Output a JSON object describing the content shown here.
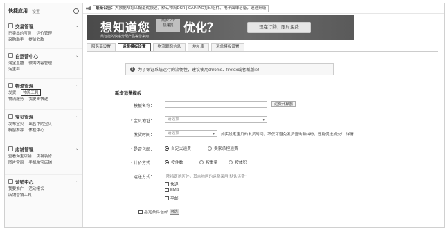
{
  "sidebar": {
    "title": "快捷应用",
    "settings": "设置",
    "sections": [
      {
        "title": "交易管理",
        "rows": [
          [
            "已卖出的宝贝",
            "评价管理"
          ],
          [
            "采购助手",
            "提前收款"
          ]
        ]
      },
      {
        "title": "自运营中心",
        "rows": [
          [
            "淘宝直播",
            "微淘内容管理"
          ],
          [
            "淘宝群"
          ]
        ]
      },
      {
        "title": "物流管理",
        "rows": [
          [
            "发货",
            "物流工具"
          ],
          [
            "物流服务",
            "我要寄快递"
          ]
        ]
      },
      {
        "title": "宝贝管理",
        "rows": [
          [
            "发布宝贝",
            "出售中的宝贝"
          ],
          [
            "橱窗推荐",
            "体检中心"
          ]
        ]
      },
      {
        "title": "店铺管理",
        "rows": [
          [
            "查看淘宝店铺",
            "店铺装修"
          ],
          [
            "图片空间",
            "手机淘宝店铺"
          ]
        ]
      },
      {
        "title": "营销中心",
        "rows": [
          [
            "我要推广",
            "活动报名"
          ],
          [
            "店铺营销工具"
          ]
        ]
      }
    ]
  },
  "notice": {
    "label": "最新公告：",
    "text": "大数据帮您匹配最优快递，默认物流DSR | CAINIAO打印组件、电子面单必备，速速升级"
  },
  "banner": {
    "headline_a": "想知道您",
    "box_line1": "最多少个",
    "box_line2": "快递员",
    "headline_b": "优化？",
    "subtitle": "最智能的快递分配产品等您来用！",
    "cta": "现在订购，限时免费"
  },
  "tabs": [
    "服务商设置",
    "运费模板设置",
    "物流跟踪信息",
    "地址库",
    "运单模板设置"
  ],
  "active_tab": "运费模板设置",
  "tip": "为了保证系统运行的流畅性，建议使用chrome、firefox或者新版ie！",
  "form": {
    "title": "新增运费模板",
    "template_name_label": "模板名称：",
    "template_name_value": "",
    "calc_button": "运费计算器",
    "location_label": "宝贝地址：",
    "location_placeholder": "请选择",
    "ship_time_label": "发货时间：",
    "ship_time_placeholder": "请选择",
    "ship_time_note": "如实设定宝贝的发货时间，不仅可避免发货咨询和纠纷，还能促进成交！",
    "ship_time_link": "详情",
    "free_ship_label": "是否包邮：",
    "free_ship_options": [
      "自定义运费",
      "卖家承担运费"
    ],
    "free_ship_selected": "自定义运费",
    "pricing_label": "计价方式：",
    "pricing_options": [
      "按件数",
      "按重量",
      "按体积"
    ],
    "pricing_selected": "按件数",
    "delivery_label": "运送方式：",
    "delivery_hint": "除指定地区外，其余地区的运费采用“默认运费”",
    "delivery_options": [
      "快递",
      "EMS",
      "平邮"
    ],
    "conditional_free": "指定条件包邮",
    "conditional_free_tag": "可选"
  },
  "colors": {
    "banner_bg": "#555555",
    "active_tab_border": "#555555"
  }
}
